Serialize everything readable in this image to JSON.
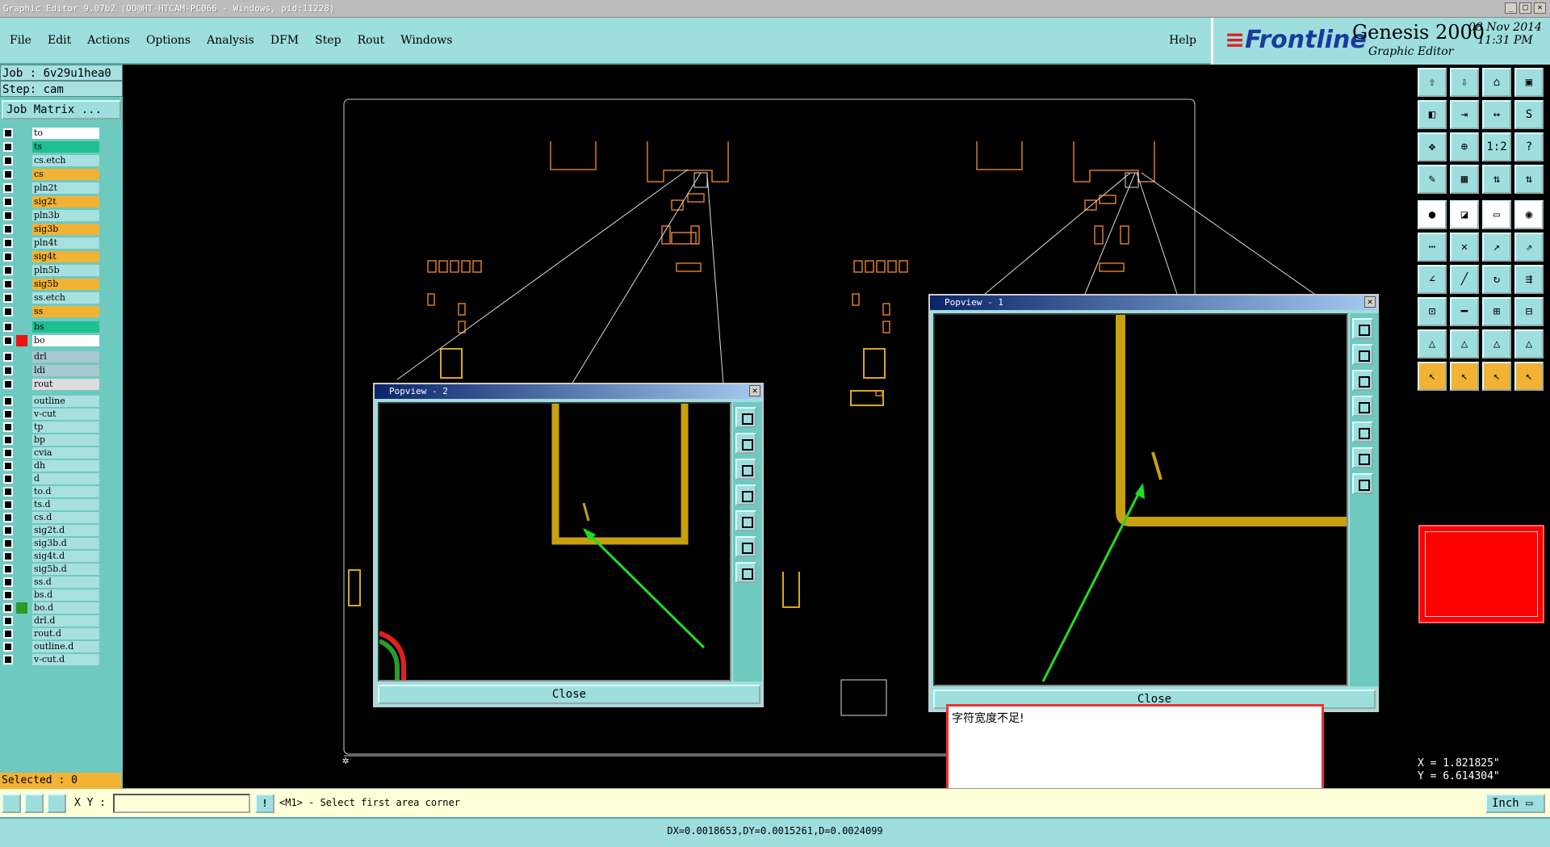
{
  "window": {
    "title": "Graphic Editor 9.07b2 (OO@HT-HTCAM-PC066 - Windows, pid:11228)",
    "minimize": "_",
    "maximize": "□",
    "close": "✕"
  },
  "menu": {
    "items": [
      "File",
      "Edit",
      "Actions",
      "Options",
      "Analysis",
      "DFM",
      "Step",
      "Rout",
      "Windows"
    ],
    "help": "Help"
  },
  "brand": {
    "logo": "Frontline",
    "product": "Genesis 2000",
    "subtitle": "Graphic Editor",
    "date": "08 Nov 2014",
    "time": "11:31 PM"
  },
  "job": {
    "job_label": "Job : 6v29u1hea0",
    "step_label": "Step: cam",
    "matrix_button": "Job Matrix ..."
  },
  "layers": [
    {
      "name": "to",
      "color": "#ffffff"
    },
    {
      "name": "ts",
      "color": "#1fbf8f"
    },
    {
      "name": "cs.etch",
      "color": "#a8e0e0"
    },
    {
      "name": "cs",
      "color": "#f2b233"
    },
    {
      "name": "pln2t",
      "color": "#a8e0e0"
    },
    {
      "name": "sig2t",
      "color": "#f2b233"
    },
    {
      "name": "pln3b",
      "color": "#a8e0e0"
    },
    {
      "name": "sig3b",
      "color": "#f2b233"
    },
    {
      "name": "pln4t",
      "color": "#a8e0e0"
    },
    {
      "name": "sig4t",
      "color": "#f2b233"
    },
    {
      "name": "pln5b",
      "color": "#a8e0e0"
    },
    {
      "name": "sig5b",
      "color": "#f2b233"
    },
    {
      "name": "ss.etch",
      "color": "#a8e0e0"
    },
    {
      "name": "ss",
      "color": "#f2b233"
    },
    {
      "name": "bs",
      "color": "#1fbf8f"
    },
    {
      "name": "bo",
      "color": "#ffffff"
    },
    {
      "name": "drl",
      "color": "#a8c8d0"
    },
    {
      "name": "ldi",
      "color": "#a8c8d0"
    },
    {
      "name": "rout",
      "color": "#dddddd"
    },
    {
      "name": "outline",
      "color": "#a8e0e0"
    },
    {
      "name": "v-cut",
      "color": "#a8e0e0"
    },
    {
      "name": "tp",
      "color": "#a8e0e0"
    },
    {
      "name": "bp",
      "color": "#a8e0e0"
    },
    {
      "name": "cvia",
      "color": "#a8e0e0"
    },
    {
      "name": "dh",
      "color": "#a8e0e0"
    },
    {
      "name": "d",
      "color": "#a8e0e0"
    },
    {
      "name": "to.d",
      "color": "#a8e0e0"
    },
    {
      "name": "ts.d",
      "color": "#a8e0e0"
    },
    {
      "name": "cs.d",
      "color": "#a8e0e0"
    },
    {
      "name": "sig2t.d",
      "color": "#a8e0e0"
    },
    {
      "name": "sig3b.d",
      "color": "#a8e0e0"
    },
    {
      "name": "sig4t.d",
      "color": "#a8e0e0"
    },
    {
      "name": "sig5b.d",
      "color": "#a8e0e0"
    },
    {
      "name": "ss.d",
      "color": "#a8e0e0"
    },
    {
      "name": "bs.d",
      "color": "#a8e0e0"
    },
    {
      "name": "bo.d",
      "color": "#a8e0e0"
    },
    {
      "name": "drl.d",
      "color": "#a8e0e0"
    },
    {
      "name": "rout.d",
      "color": "#a8e0e0"
    },
    {
      "name": "outline.d",
      "color": "#a8e0e0"
    },
    {
      "name": "v-cut.d",
      "color": "#a8e0e0"
    }
  ],
  "canvas_labels": {
    "left_text": "□□□□□",
    "right_text": "□□□□□"
  },
  "popup1": {
    "title": "Popview - 1",
    "close": "Close"
  },
  "popup2": {
    "title": "Popview - 2",
    "close": "Close"
  },
  "message": "字符宽度不足!",
  "selected": "Selected : 0",
  "xy_label": "X Y :",
  "xy_value": "",
  "prompt": "<M1> - Select first area corner",
  "units": "Inch",
  "coords": {
    "x": "X = 1.821825\"",
    "y": "Y = 6.614304\""
  },
  "status": "DX=0.0018653,DY=0.0015261,D=0.0024099"
}
